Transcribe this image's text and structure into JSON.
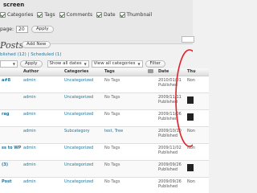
{
  "screen_options": {
    "title": "screen",
    "columns": [
      {
        "label": "Categories",
        "checked": true
      },
      {
        "label": "Tags",
        "checked": true
      },
      {
        "label": "Comments",
        "checked": true
      },
      {
        "label": "Date",
        "checked": true
      },
      {
        "label": "Thumbnail",
        "checked": true
      }
    ],
    "per_page_label": "page:",
    "per_page_value": "20",
    "apply_label": "Apply"
  },
  "header": {
    "title": "Posts",
    "add_new_label": "Add New"
  },
  "subsubsub": {
    "items": [
      {
        "label": "blished",
        "count": "(12)",
        "sep": "|"
      },
      {
        "label": "Scheduled",
        "count": "(1)",
        "sep": ""
      }
    ]
  },
  "tablenav": {
    "bulk_action": "",
    "apply_label": "Apply",
    "date_filter": "Show all dates",
    "category_filter": "View all categories",
    "filter_label": "Filter"
  },
  "table": {
    "columns": [
      "Author",
      "Categories",
      "Tags",
      "Date",
      "Thu"
    ],
    "rows": [
      {
        "title": "a#8",
        "author": "admin",
        "category": "Uncategorized",
        "tags": "No Tags",
        "date": "2010/01/01",
        "status": "Published",
        "thumb": "Non",
        "thumb_image": false
      },
      {
        "title": "",
        "author": "admin",
        "category": "Uncategorized",
        "tags": "No Tags",
        "date": "2009/11/11",
        "status": "Published",
        "thumb": "",
        "thumb_image": true
      },
      {
        "title": "rag",
        "author": "admin",
        "category": "Uncategorized",
        "tags": "No Tags",
        "date": "2009/11/06",
        "status": "Published",
        "thumb": "",
        "thumb_image": true
      },
      {
        "title": "",
        "author": "admin",
        "category": "Subcategory",
        "tags": "test, Tree",
        "date": "2009/10/10",
        "status": "Published",
        "thumb": "Non",
        "thumb_image": false
      },
      {
        "title": "ss to WP !",
        "author": "admin",
        "category": "Uncategorized",
        "tags": "No Tags",
        "date": "2009/11/02",
        "status": "Published",
        "thumb": "Non",
        "thumb_image": false
      },
      {
        "title": "(3)",
        "author": "admin",
        "category": "Uncategorized",
        "tags": "No Tags",
        "date": "2009/09/26",
        "status": "Published",
        "thumb": "",
        "thumb_image": true
      },
      {
        "title": "Post",
        "author": "admin",
        "category": "Uncategorized",
        "tags": "No Tags",
        "date": "2009/09/26",
        "status": "Published",
        "thumb": "Non",
        "thumb_image": false
      }
    ]
  },
  "colors": {
    "link": "#21759b",
    "annotation": "#e0202a",
    "background": "#f1f1f1"
  }
}
